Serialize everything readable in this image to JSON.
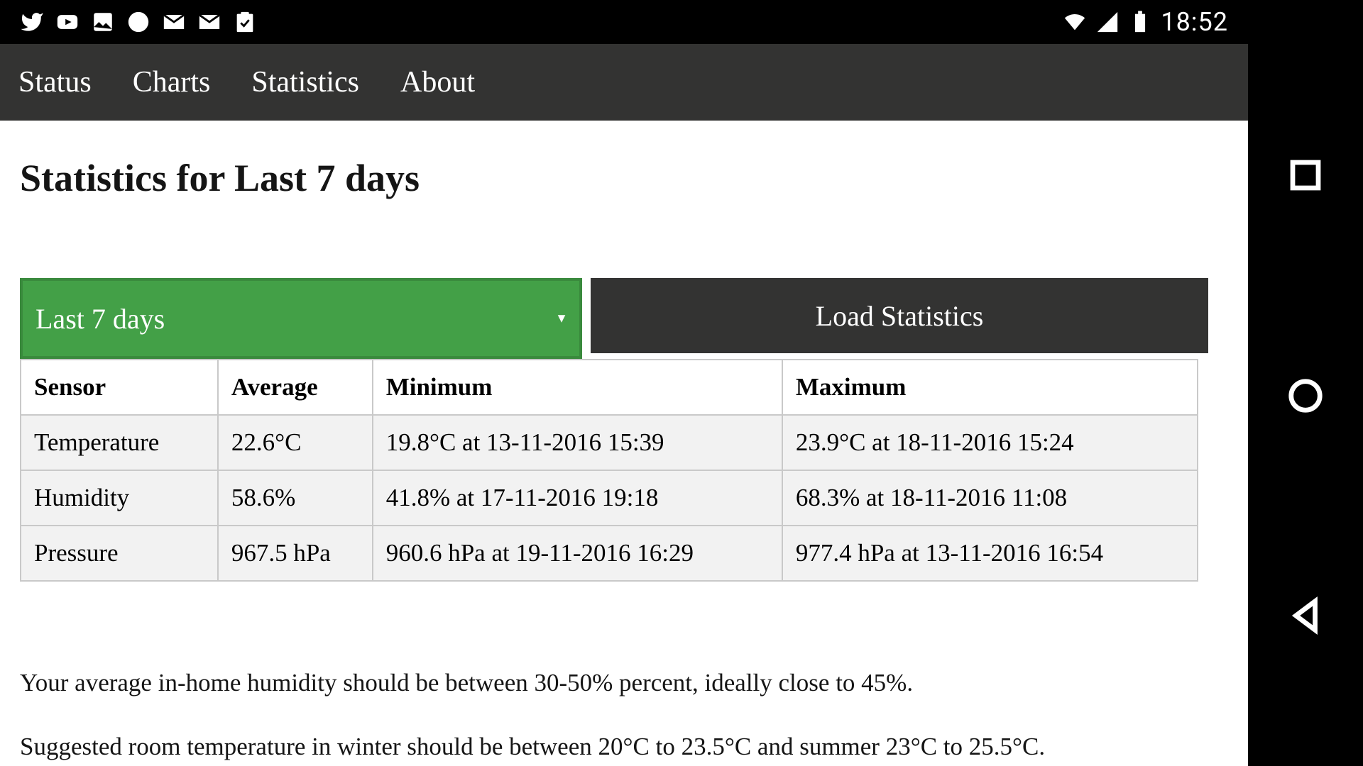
{
  "status_bar": {
    "clock": "18:52"
  },
  "nav": {
    "status": "Status",
    "charts": "Charts",
    "statistics": "Statistics",
    "about": "About"
  },
  "page": {
    "title": "Statistics for Last 7 days"
  },
  "controls": {
    "period_selected": "Last 7 days",
    "load_button": "Load Statistics"
  },
  "table": {
    "headers": {
      "sensor": "Sensor",
      "average": "Average",
      "minimum": "Minimum",
      "maximum": "Maximum"
    },
    "rows": [
      {
        "sensor": "Temperature",
        "average": "22.6°C",
        "minimum": "19.8°C at 13-11-2016 15:39",
        "maximum": "23.9°C at 18-11-2016 15:24"
      },
      {
        "sensor": "Humidity",
        "average": "58.6%",
        "minimum": "41.8% at 17-11-2016 19:18",
        "maximum": "68.3% at 18-11-2016 11:08"
      },
      {
        "sensor": "Pressure",
        "average": "967.5 hPa",
        "minimum": "960.6 hPa at 19-11-2016 16:29",
        "maximum": "977.4 hPa at 13-11-2016 16:54"
      }
    ]
  },
  "advice": {
    "humidity": "Your average in-home humidity should be between 30-50% percent, ideally close to 45%.",
    "temperature": "Suggested room temperature in winter should be between 20°C to 23.5°C and summer 23°C to 25.5°C."
  }
}
